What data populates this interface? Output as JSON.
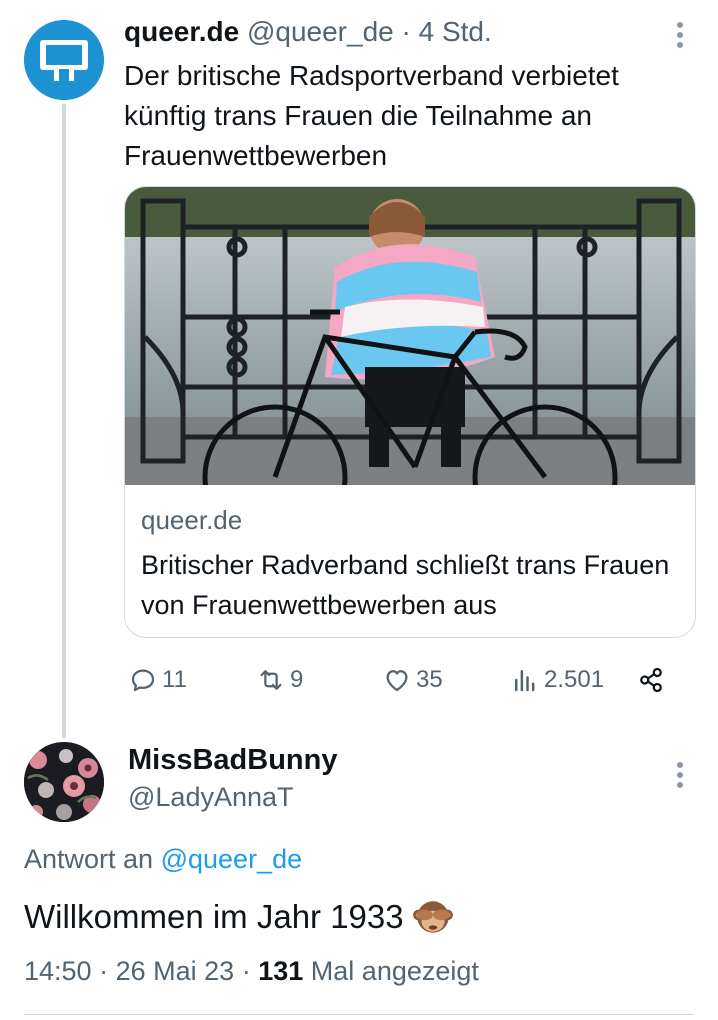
{
  "tweet": {
    "author_name": "queer.de",
    "author_handle": "@queer_de",
    "separator": "·",
    "time_ago": "4 Std.",
    "text": "Der britische Radsportverband verbietet künftig trans Frauen die Teilnahme an Frauenwettbewerben",
    "card": {
      "domain": "queer.de",
      "title": "Britischer Radverband schließt trans Frauen von Frauenwettbewerben aus"
    },
    "stats": {
      "replies": "11",
      "retweets": "9",
      "likes": "35",
      "views": "2.501"
    },
    "icons": [
      "reply-icon",
      "retweet-icon",
      "like-icon",
      "views-icon",
      "share-icon",
      "more-icon"
    ]
  },
  "reply": {
    "author_name": "MissBadBunny",
    "author_handle": "@LadyAnnaT",
    "reply_prefix": "Antwort an",
    "reply_target": "@queer_de",
    "text": "Willkommen im Jahr 1933",
    "emoji": "see-no-evil-monkey",
    "time": "14:50",
    "date": "26 Mai 23",
    "view_count": "131",
    "view_suffix": "Mal angezeigt"
  },
  "colors": {
    "accent": "#1d9bf0",
    "queer_brand": "#1d93d2",
    "muted_text": "#536471",
    "text": "#0f1419",
    "border": "#cfd9de"
  }
}
